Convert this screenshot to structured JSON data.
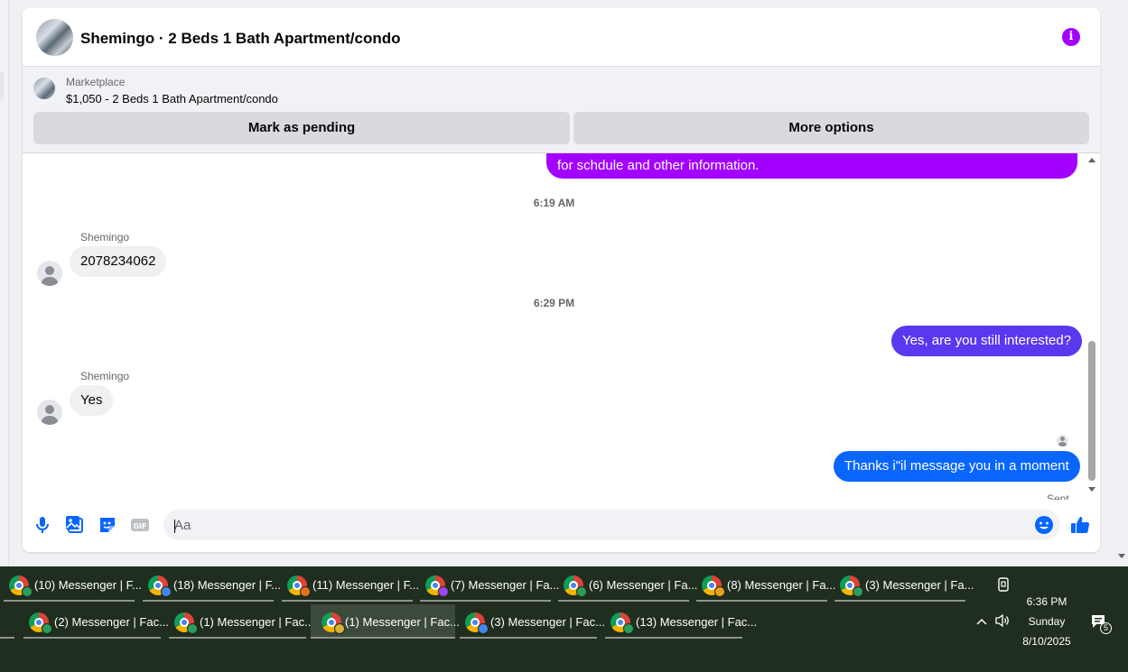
{
  "header": {
    "title": "Shemingo · 2 Beds 1 Bath Apartment/condo",
    "info_icon": "info-icon"
  },
  "marketplace": {
    "label": "Marketplace",
    "item": "$1,050 - 2 Beds 1 Bath Apartment/condo",
    "pending_button": "Mark as pending",
    "more_button": "More options"
  },
  "messages": [
    {
      "type": "outgoing",
      "text": "for schdule and other information.",
      "color": "#a200ff"
    },
    {
      "type": "timestamp",
      "text": "6:19 AM"
    },
    {
      "type": "incoming",
      "sender": "Shemingo",
      "text": "2078234062"
    },
    {
      "type": "timestamp",
      "text": "6:29 PM"
    },
    {
      "type": "outgoing",
      "text": "Yes, are you still interested?",
      "color": "#5a38f0"
    },
    {
      "type": "incoming",
      "sender": "Shemingo",
      "text": "Yes"
    },
    {
      "type": "outgoing",
      "text": "Thanks i\"il message you in a moment",
      "color": "#0866ff"
    }
  ],
  "status": {
    "sent": "Sent"
  },
  "composer": {
    "placeholder": "Aa",
    "icons": [
      "microphone-icon",
      "photo-icon",
      "sticker-icon",
      "gif-icon",
      "emoji-icon",
      "thumbs-up-icon"
    ]
  },
  "colors": {
    "accent": "#0866ff",
    "brand_purple": "#a200ff",
    "taskbar": "#1f2e1e"
  },
  "taskbar": {
    "row1": [
      {
        "label": "(10) Messenger | F...",
        "badge": "#2a9d5c"
      },
      {
        "label": "(18) Messenger | F...",
        "badge": "#4285f4"
      },
      {
        "label": "(11) Messenger | F...",
        "badge": "#e8711a"
      },
      {
        "label": "(7) Messenger | Fa...",
        "badge": "#a142f4"
      },
      {
        "label": "(6) Messenger | Fa...",
        "badge": "#2a9d5c"
      },
      {
        "label": "(8) Messenger | Fa...",
        "badge": "#e8a317"
      },
      {
        "label": "(3) Messenger | Fa...",
        "badge": "#2a9d5c"
      }
    ],
    "row2": [
      {
        "label": "(2) Messenger | Fac...",
        "badge": "#2a9d5c"
      },
      {
        "label": "(1) Messenger | Fac...",
        "badge": "#2a9d5c"
      },
      {
        "label": "(1) Messenger | Fac...",
        "badge": "#d8b33a"
      },
      {
        "label": "(3) Messenger | Fac...",
        "badge": "#4285f4"
      },
      {
        "label": "(13) Messenger | Fac...",
        "badge": "#2a9d5c"
      }
    ],
    "clock": {
      "time": "6:36 PM",
      "day": "Sunday",
      "date": "8/10/2025"
    },
    "notifications": "5"
  }
}
